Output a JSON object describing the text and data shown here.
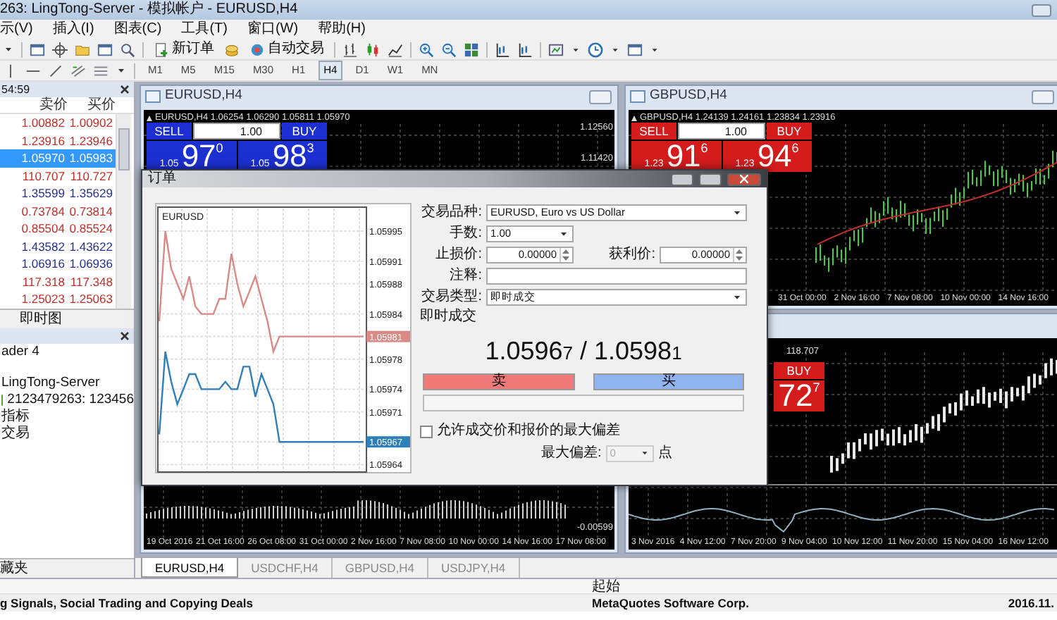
{
  "window": {
    "title": "263: LingTong-Server - 模拟帐户 - EURUSD,H4"
  },
  "menu": [
    "示(V)",
    "插入(I)",
    "图表(C)",
    "工具(T)",
    "窗口(W)",
    "帮助(H)"
  ],
  "toolbar": {
    "new_order": "新订单",
    "auto_trading": "自动交易"
  },
  "timeframes": [
    {
      "label": "M1",
      "selected": false
    },
    {
      "label": "M5",
      "selected": false
    },
    {
      "label": "M15",
      "selected": false
    },
    {
      "label": "M30",
      "selected": false
    },
    {
      "label": "H1",
      "selected": false
    },
    {
      "label": "H4",
      "selected": true
    },
    {
      "label": "D1",
      "selected": false
    },
    {
      "label": "W1",
      "selected": false
    },
    {
      "label": "MN",
      "selected": false
    }
  ],
  "market_watch": {
    "time": "54:59",
    "columns": [
      "卖价",
      "买价"
    ],
    "rows": [
      {
        "bid": "1.00882",
        "ask": "1.00902",
        "color": "#c0302a",
        "selected": false
      },
      {
        "bid": "1.23916",
        "ask": "1.23946",
        "color": "#c0302a",
        "selected": false
      },
      {
        "bid": "1.05970",
        "ask": "1.05983",
        "selected": true
      },
      {
        "bid": "110.707",
        "ask": "110.727",
        "color": "#c0302a",
        "selected": false
      },
      {
        "bid": "1.35599",
        "ask": "1.35629",
        "color": "#24308f",
        "selected": false
      },
      {
        "bid": "0.73784",
        "ask": "0.73814",
        "color": "#c0302a",
        "selected": false
      },
      {
        "bid": "0.85504",
        "ask": "0.85524",
        "color": "#c0302a",
        "selected": false
      },
      {
        "bid": "1.43582",
        "ask": "1.43622",
        "color": "#24308f",
        "selected": false
      },
      {
        "bid": "1.06916",
        "ask": "1.06936",
        "color": "#24308f",
        "selected": false
      },
      {
        "bid": "117.318",
        "ask": "117.348",
        "color": "#c0302a",
        "selected": false
      },
      {
        "bid": "1.25023",
        "ask": "1.25063",
        "color": "#c0302a",
        "selected": false
      }
    ],
    "tab": "即时图"
  },
  "navigator": {
    "items": [
      {
        "label": "ader 4",
        "kind": "heading"
      },
      {
        "label": "LingTong-Server",
        "kind": "server"
      },
      {
        "label": "2123479263: 123456",
        "kind": "account"
      },
      {
        "label": "指标",
        "kind": "folder"
      },
      {
        "label": "交易",
        "kind": "folder"
      }
    ],
    "tab": "藏夹"
  },
  "charts": [
    {
      "title": "EURUSD,H4",
      "info": "EURUSD,H4  1.06254 1.06290 1.05811 1.05970",
      "trade_panel": {
        "color": "#1c2fd0",
        "sell": "SELL",
        "lot": "1.00",
        "buy": "BUY",
        "sell_price": "$_{1.05}$97$^{0}$",
        "buy_price": "$_{1.05}$98$^{3}$"
      },
      "price_labels": [
        "1.12560",
        "1.11420"
      ],
      "indicator_label": "-0.00599",
      "time_labels": [
        "19 Oct 2016",
        "21 Oct 16:00",
        "26 Oct 08:00",
        "31 Oct 00:00",
        "2 Nov 16:00",
        "7 Nov 08:00",
        "10 Nov 00:00",
        "14 Nov 16:00",
        "17 Nov 08:00"
      ]
    },
    {
      "title": "GBPUSD,H4",
      "info": "GBPUSD,H4  1.24139 1.24161 1.23834 1.23916",
      "trade_panel": {
        "color": "#d41c1c",
        "sell": "SELL",
        "lot": "1.00",
        "buy": "BUY",
        "sell_price": "$_{1.23}$91$^{6}$",
        "buy_price": "$_{1.23}$94$^{6}$"
      },
      "time_labels": [
        "31 Oct 00:00",
        "2 Nov 16:00",
        "7 Nov 08:00",
        "10 Nov 00:00",
        "14 Nov 16:00"
      ]
    },
    {
      "info": "118.707",
      "trade_panel": {
        "color": "#d41c1c",
        "buy": "BUY",
        "buy_price": "72$^{7}$"
      },
      "time_labels": [
        "3 Nov 2016",
        "4 Nov 12:00",
        "7 Nov 20:00",
        "9 Nov 04:00",
        "10 Nov 12:00",
        "11 Nov 20:00",
        "15 Nov 04:00",
        "16 Nov 12:00"
      ]
    }
  ],
  "chart_tabs": [
    {
      "label": "EURUSD,H4",
      "selected": true
    },
    {
      "label": "USDCHF,H4",
      "selected": false
    },
    {
      "label": "GBPUSD,H4",
      "selected": false
    },
    {
      "label": "USDJPY,H4",
      "selected": false
    }
  ],
  "signals": {
    "column": "起始",
    "row": [
      "g Signals, Social Trading and Copying Deals",
      "MetaQuotes Software Corp.",
      "2016.11."
    ]
  },
  "order_dialog": {
    "title": "订单",
    "chart_data": {
      "type": "line",
      "title": "EURUSD",
      "grid": true,
      "ylim": [
        1.05963,
        1.05998
      ],
      "yticks": [
        1.05995,
        1.05991,
        1.05988,
        1.05984,
        1.05981,
        1.05978,
        1.05974,
        1.05971,
        1.05967,
        1.05964
      ],
      "series": [
        {
          "color": "#d98a86",
          "values": [
            1.05983,
            1.05995,
            1.0599,
            1.05988,
            1.05986,
            1.05989,
            1.05985,
            1.05984,
            1.05984,
            1.05984,
            1.05986,
            1.05986,
            1.05992,
            1.05988,
            1.05985,
            1.05987,
            1.05989,
            1.05986,
            1.05983,
            1.05979,
            1.05981,
            1.05981,
            1.05981,
            1.05981,
            1.05981,
            1.05981,
            1.05981,
            1.05981,
            1.05981,
            1.05981,
            1.05981,
            1.05981,
            1.05981,
            1.05981,
            1.05981
          ]
        },
        {
          "color": "#2f7fb8",
          "values": [
            1.05968,
            1.05979,
            1.05975,
            1.05972,
            1.05974,
            1.05976,
            1.05976,
            1.05974,
            1.05974,
            1.05974,
            1.05974,
            1.05975,
            1.05974,
            1.05974,
            1.05977,
            1.05977,
            1.05973,
            1.05976,
            1.05974,
            1.05972,
            1.05967,
            1.05967,
            1.05967,
            1.05967,
            1.05967,
            1.05967,
            1.05967,
            1.05967,
            1.05967,
            1.05967,
            1.05967,
            1.05967,
            1.05967,
            1.05967,
            1.05967
          ]
        }
      ]
    },
    "fields": [
      {
        "label": "交易品种:",
        "kind": "dropdown",
        "value": "EURUSD, Euro vs US Dollar"
      },
      {
        "label": "手数:",
        "kind": "combo",
        "value": "1.00"
      },
      {
        "label": "止损价:",
        "kind": "spinner",
        "value": "0.00000"
      },
      {
        "label": "获利价:",
        "kind": "spinner",
        "value": "0.00000"
      },
      {
        "label": "注释:",
        "kind": "text"
      },
      {
        "label": "交易类型:",
        "kind": "dropdown",
        "value": "即时成交"
      }
    ],
    "section": "即时成交",
    "quote": "1.0596$_{7}$ / 1.0598$_{1}$",
    "sell_button": "卖",
    "buy_button": "买",
    "deviation": {
      "label": "允许成交价和报价的最大偏差",
      "checked": false
    },
    "max_deviation": {
      "label": "最大偏差:",
      "value": "0",
      "unit": "点",
      "disabled": true
    }
  }
}
